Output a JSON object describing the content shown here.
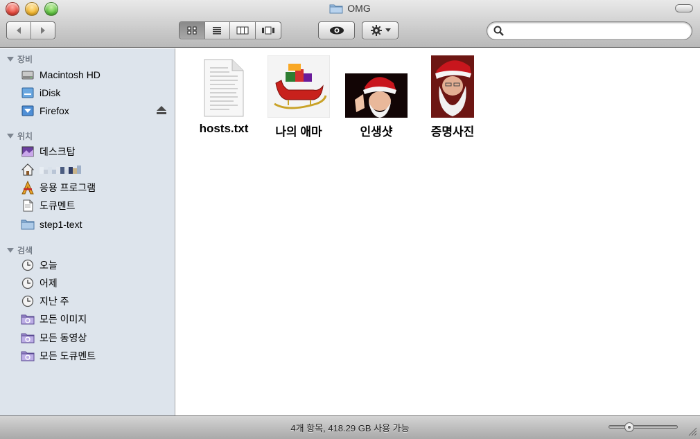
{
  "window": {
    "title": "OMG"
  },
  "toolbar": {
    "back_icon": "back-arrow-icon",
    "forward_icon": "forward-arrow-icon",
    "views": [
      "icon-view-icon",
      "list-view-icon",
      "column-view-icon",
      "coverflow-view-icon"
    ],
    "active_view": "icon-view-icon",
    "quicklook_icon": "eye-icon",
    "action_icon": "gear-icon",
    "search": {
      "placeholder": "",
      "value": ""
    }
  },
  "sidebar": {
    "sections": [
      {
        "title": "장비",
        "items": [
          {
            "label": "Macintosh HD",
            "icon": "hard-drive-icon"
          },
          {
            "label": "iDisk",
            "icon": "idisk-icon"
          },
          {
            "label": "Firefox",
            "icon": "disk-image-icon",
            "eject": true
          }
        ]
      },
      {
        "title": "위치",
        "items": [
          {
            "label": "데스크탑",
            "icon": "desktop-icon"
          },
          {
            "label": "",
            "icon": "home-icon",
            "redacted": true
          },
          {
            "label": "응용 프로그램",
            "icon": "applications-icon"
          },
          {
            "label": "도큐멘트",
            "icon": "documents-icon"
          },
          {
            "label": "step1-text",
            "icon": "folder-icon"
          }
        ]
      },
      {
        "title": "검색",
        "items": [
          {
            "label": "오늘",
            "icon": "clock-icon"
          },
          {
            "label": "어제",
            "icon": "clock-icon"
          },
          {
            "label": "지난 주",
            "icon": "clock-icon"
          },
          {
            "label": "모든 이미지",
            "icon": "smart-folder-icon"
          },
          {
            "label": "모든 동영상",
            "icon": "smart-folder-icon"
          },
          {
            "label": "모든 도큐멘트",
            "icon": "smart-folder-icon"
          }
        ]
      }
    ]
  },
  "files": [
    {
      "name": "hosts.txt",
      "icon": "text-document-icon"
    },
    {
      "name": "나의 애마",
      "icon": "sleigh-image-icon"
    },
    {
      "name": "인생샷",
      "icon": "santa-photo-icon"
    },
    {
      "name": "증명사진",
      "icon": "santa-portrait-icon"
    }
  ],
  "status": {
    "text": "4개 항목, 418.29 GB 사용 가능",
    "zoom_level": 0.25
  },
  "colors": {
    "sidebar_bg": "#dde4ec",
    "section_header": "#717a86",
    "folder_blue": "#8fb4d8"
  }
}
